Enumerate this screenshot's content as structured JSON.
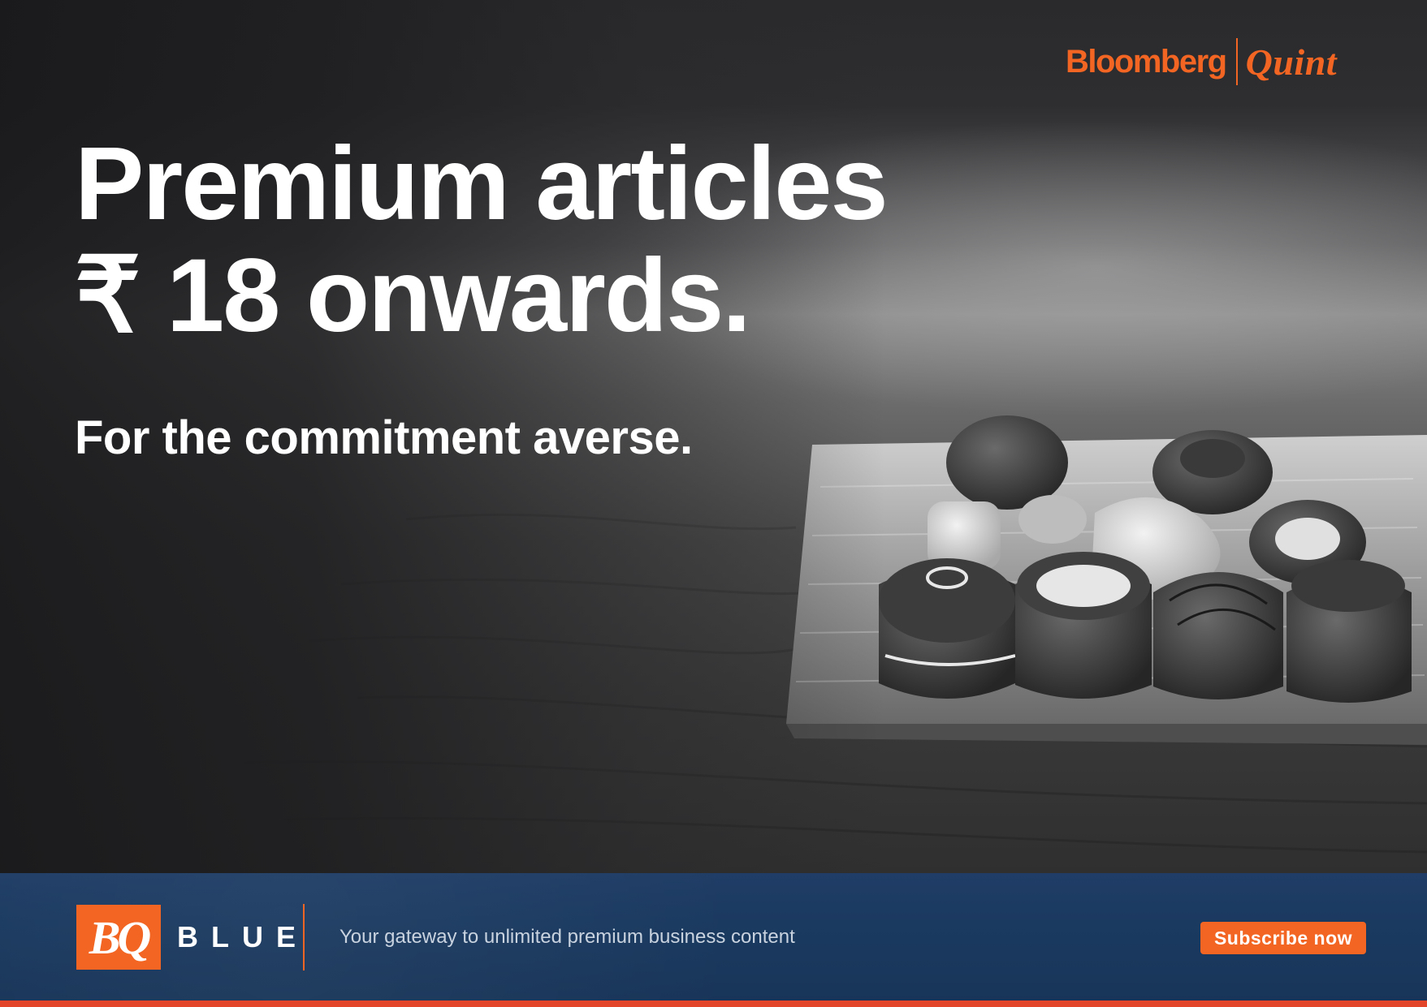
{
  "brand": {
    "name_part1": "Bloomberg",
    "name_part2": "Quint",
    "color": "#f26522"
  },
  "headline": {
    "line1": "Premium articles",
    "line2": "₹ 18 onwards.",
    "subline": "For the commitment averse."
  },
  "hero_image": {
    "subject": "plate of chocolates on wooden table"
  },
  "banner": {
    "logo_text": "BQ",
    "product": "BLUE",
    "tagline": "Your gateway to unlimited premium business content",
    "cta_label": "Subscribe now",
    "background_color": "#1b3a60",
    "accent_color": "#f26522"
  }
}
